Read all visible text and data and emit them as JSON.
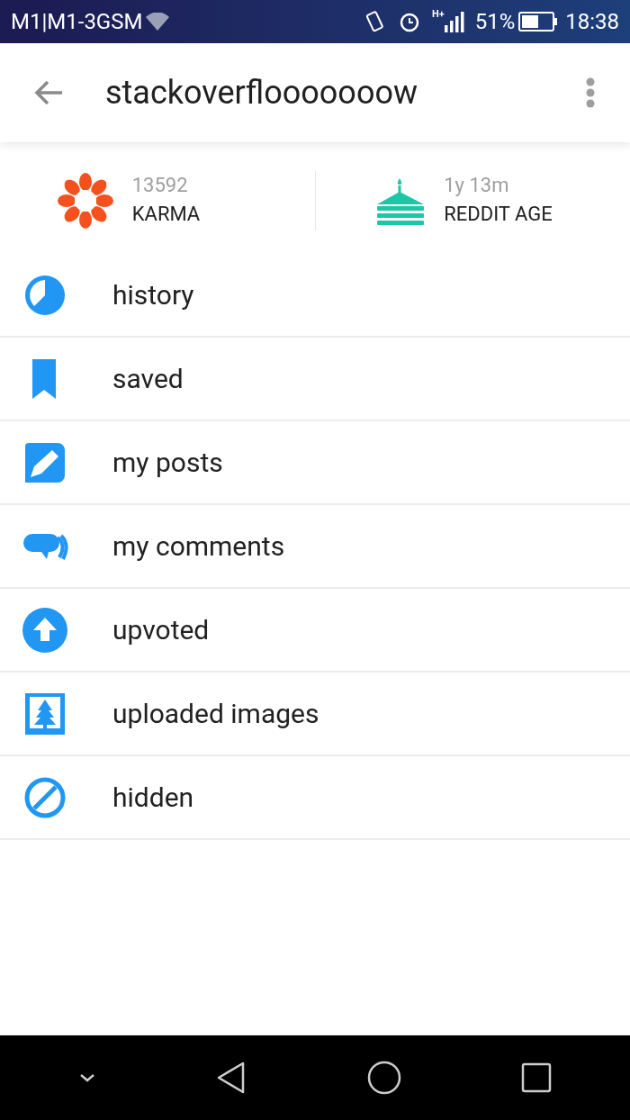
{
  "status_bar": {
    "carrier": "M1|M1-3GSM",
    "network": "H+",
    "battery": "51%",
    "time": "18:38"
  },
  "app_bar": {
    "title": "stackoverflooooooow"
  },
  "stats": [
    {
      "kind": "karma",
      "value": "13592",
      "label": "KARMA"
    },
    {
      "kind": "age",
      "value": "1y 13m",
      "label": "REDDIT AGE"
    }
  ],
  "menu": [
    {
      "kind": "history",
      "label": "history"
    },
    {
      "kind": "saved",
      "label": "saved"
    },
    {
      "kind": "posts",
      "label": "my posts"
    },
    {
      "kind": "comments",
      "label": "my comments"
    },
    {
      "kind": "upvoted",
      "label": "upvoted"
    },
    {
      "kind": "images",
      "label": "uploaded images"
    },
    {
      "kind": "hidden",
      "label": "hidden"
    }
  ]
}
